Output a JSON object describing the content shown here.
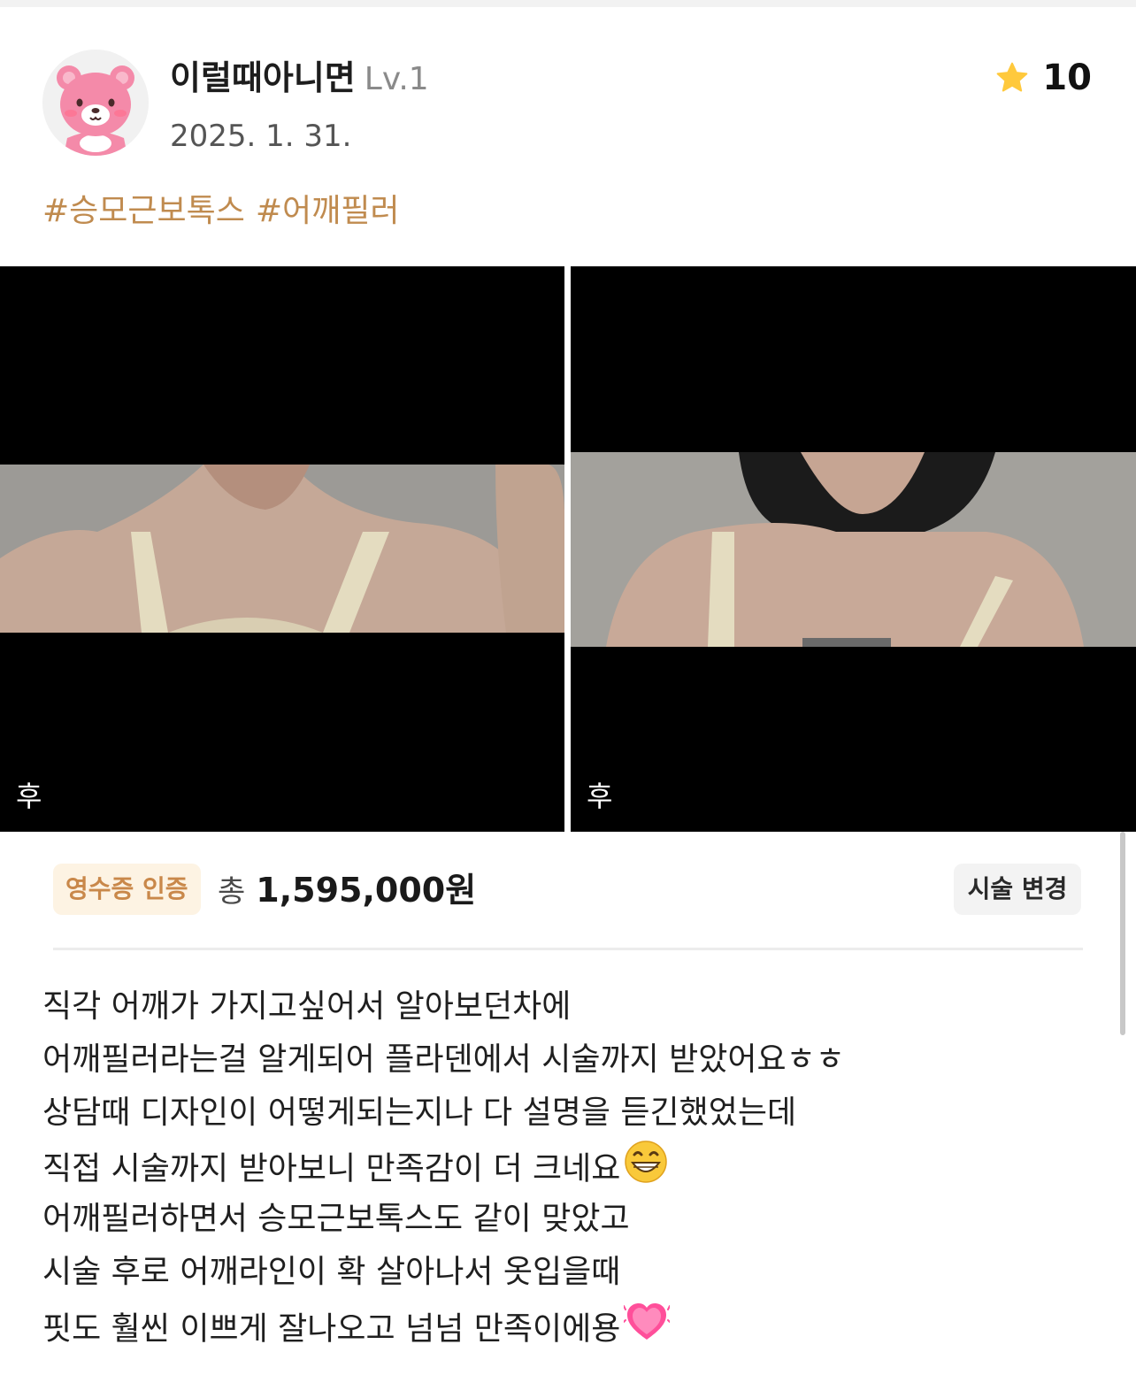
{
  "author": {
    "name": "이럴때아니면",
    "level": "Lv.1",
    "date": "2025. 1. 31.",
    "avatar_icon": "pink-bear-avatar"
  },
  "rating": {
    "icon": "star-icon",
    "value": "10",
    "star_color": "#FFC93C"
  },
  "tags": [
    "#승모근보톡스",
    "#어깨필러"
  ],
  "photos": [
    {
      "label": "후"
    },
    {
      "label": "후"
    }
  ],
  "receipt": {
    "badge": "영수증 인증",
    "total_label": "총",
    "total_amount": "1,595,000원",
    "change_button": "시술 변경"
  },
  "review": {
    "lines": [
      "직각 어깨가 가지고싶어서 알아보던차에",
      "어깨필러라는걸 알게되어 플라덴에서 시술까지 받았어요ㅎㅎ",
      "상담때 디자인이 어떻게되는지나 다 설명을 듣긴했었는데",
      "직접 시술까지 받아보니 만족감이 더 크네요",
      "어깨필러하면서 승모근보톡스도 같이 맞았고",
      "시술 후로 어깨라인이 확 살아나서 옷입을때",
      "핏도 훨씬 이쁘게 잘나오고 넘넘 만족이에용"
    ],
    "emojis": [
      "grinning-face-emoji",
      "growing-heart-emoji"
    ]
  },
  "colors": {
    "tag": "#C08B4F",
    "badge_bg": "#FDF3E3",
    "badge_text": "#C9884A"
  }
}
